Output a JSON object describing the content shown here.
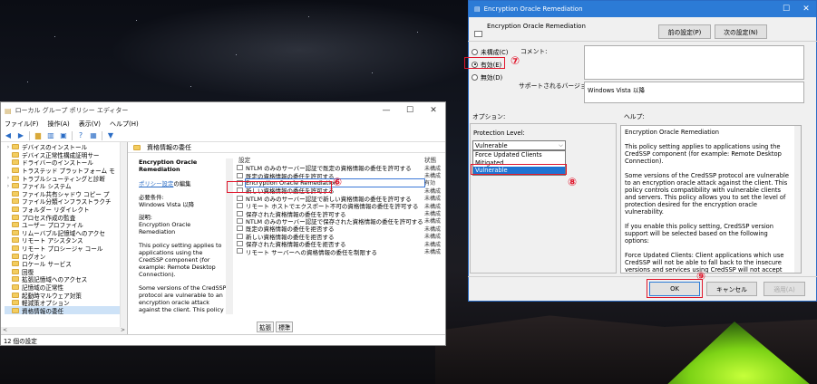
{
  "gpo": {
    "title": "ローカル グループ ポリシー エディター",
    "menu": [
      "ファイル(F)",
      "操作(A)",
      "表示(V)",
      "ヘルプ(H)"
    ],
    "tree_items": [
      "デバイスのインストール",
      "デバイス正常性構成証明サー",
      "ドライバーのインストール",
      "トラステッド プラットフォーム モ",
      "トラブルシューティングと診断",
      "ファイル システム",
      "ファイル共有シャドウ コピー プ",
      "ファイル分類インフラストラクチ",
      "フォルダー リダイレクト",
      "プロセス作成の監査",
      "ユーザー プロファイル",
      "リムーバブル記憶域へのアクセ",
      "リモート アシスタンス",
      "リモート プロシージャ コール",
      "ログオン",
      "ロケール サービス",
      "回復",
      "拡張記憶域へのアクセス",
      "記憶域の正常性",
      "起動時マルウェア対策",
      "軽減策オプション",
      "資格情報の委任"
    ],
    "right_header": "資格情報の委任",
    "desc": {
      "title": "Encryption Oracle Remediation",
      "edit_prefix": "ポリシー設定",
      "edit_suffix": "の編集",
      "req_label": "必要条件:",
      "req_value": "Windows Vista 以降",
      "desc_label": "説明:",
      "desc_value": "Encryption Oracle Remediation",
      "p1": "This policy setting applies to applications using the CredSSP component (for example: Remote Desktop Connection).",
      "p2": "Some versions of the CredSSP protocol are vulnerable to an encryption oracle attack against the client.  This policy controls compatibility with vulnerable clients and servers.  This policy allows you to set the level of protection desired for the encryption oracle vulnerability."
    },
    "list_header": {
      "setting": "設定",
      "state": "状態"
    },
    "rows": [
      {
        "name": "NTLM のみのサーバー認証で既定の資格情報の委任を許可する",
        "state": "未構成"
      },
      {
        "name": "既定の資格情報の委任を許可する",
        "state": "未構成"
      },
      {
        "name": "Encryption Oracle Remediation",
        "state": "有効"
      },
      {
        "name": "新しい資格情報の委任を許可する",
        "state": "未構成"
      },
      {
        "name": "NTLM のみのサーバー認証で新しい資格情報の委任を許可する",
        "state": "未構成"
      },
      {
        "name": "リモート ホストでエクスポート不可の資格情報の委任を許可する",
        "state": "未構成"
      },
      {
        "name": "保存された資格情報の委任を許可する",
        "state": "未構成"
      },
      {
        "name": "NTLM のみのサーバー認証で保存された資格情報の委任を許可する",
        "state": "未構成"
      },
      {
        "name": "既定の資格情報の委任を拒否する",
        "state": "未構成"
      },
      {
        "name": "新しい資格情報の委任を拒否する",
        "state": "未構成"
      },
      {
        "name": "保存された資格情報の委任を拒否する",
        "state": "未構成"
      },
      {
        "name": "リモート サーバーへの資格情報の委任を制限する",
        "state": "未構成"
      }
    ],
    "tabs": [
      "拡張",
      "標準"
    ],
    "status": "12 個の設定"
  },
  "dialog": {
    "title": "Encryption Oracle Remediation",
    "policy_name": "Encryption Oracle Remediation",
    "prev_button": "前の設定(P)",
    "next_button": "次の設定(N)",
    "radio_not_configured": "未構成(C)",
    "radio_enabled": "有効(E)",
    "radio_disabled": "無効(D)",
    "comment_label": "コメント:",
    "supported_label": "サポートされるバージョン:",
    "supported_value": "Windows Vista 以降",
    "options_label": "オプション:",
    "help_label": "ヘルプ:",
    "protection_label": "Protection Level:",
    "protection_selected": "Vulnerable",
    "protection_options": [
      "Force Updated Clients",
      "Mitigated",
      "Vulnerable"
    ],
    "help_title": "Encryption Oracle Remediation",
    "help_paragraphs": [
      "This policy setting applies to applications using the CredSSP component (for example: Remote Desktop Connection).",
      "Some versions of the CredSSP protocol are vulnerable to an encryption oracle attack against the client.  This policy controls compatibility with vulnerable clients and servers.  This policy allows you to set the level of protection desired for the encryption oracle vulnerability.",
      "If you enable this policy setting, CredSSP version support will be selected based on the following options:",
      "Force Updated Clients: Client applications which use CredSSP will not be able to fall back to the insecure versions and services using CredSSP will not accept unpatched clients. Note: this setting should not be deployed until all remote hosts support the newest"
    ],
    "ok_button": "OK",
    "cancel_button": "キャンセル",
    "apply_button": "適用(A)"
  },
  "annotations": {
    "step7": "⑦",
    "step6": "⑥",
    "step8": "⑧",
    "step9": "⑨"
  },
  "colors": {
    "accent": "#2c7bd6",
    "highlight": "#e0162b",
    "selection": "#1e73d2"
  }
}
